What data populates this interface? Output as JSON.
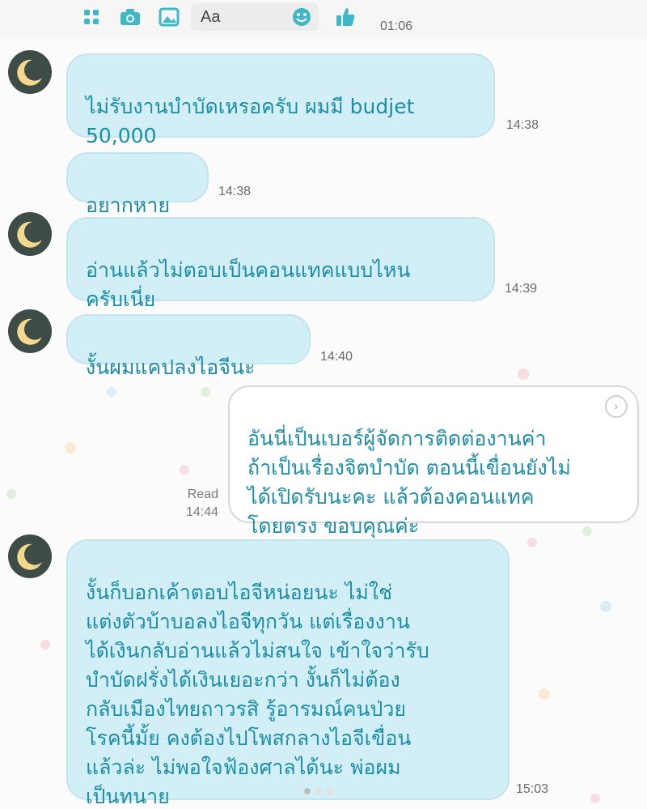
{
  "toolbar": {
    "icons": [
      "apps-icon",
      "camera-icon",
      "image-icon",
      "emoji-icon",
      "thumbs-up-icon"
    ],
    "input_placeholder": "Aa",
    "time": "01:06"
  },
  "messages": [
    {
      "sender": "other",
      "text": "ไม่รับงานบำบัดเหรอครับ ผมมี budjet\n50,000",
      "time": "14:38"
    },
    {
      "sender": "other",
      "text": "อยากหาย",
      "time": "14:38"
    },
    {
      "sender": "other",
      "text": "อ่านแล้วไม่ตอบเป็นคอนแทคแบบไหน\nครับเนี่ย",
      "time": "14:39"
    },
    {
      "sender": "other",
      "text": "งั้นผมแคปลงไอจีนะ",
      "time": "14:40"
    },
    {
      "sender": "me",
      "text": "อันนี่เป็นเบอร์ผู้จัดการติดต่องานค่า\nถ้าเป็นเรื่องจิตบำบัด ตอนนี้เขื่อนยังไม่\nได้เปิดรับนะคะ แล้วต้องคอนแทค\nโดยตรง ขอบคุณค่ะ",
      "status": "Read",
      "time": "14:44"
    },
    {
      "sender": "other",
      "text": "งั้นก็บอกเค้าตอบไอจีหน่อยนะ ไม่ใช่\nแต่งตัวบ้าบอลงไอจีทุกวัน แต่เรื่องงาน\nได้เงินกลับอ่านแล้วไม่สนใจ เข้าใจว่ารับ\nบำบัดฝรั่งได้เงินเยอะกว่า งั้นก็ไม่ต้อง\nกลับเมืองไทยถาวรสิ รู้อารมณ์คนป่วย\nโรคนี้มั้ย คงต้องไปโพสกลางไอจีเขื่อน\nแล้วล่ะ ไม่พอใจฟ้องศาลได้นะ พ่อผม\nเป็นทนาย",
      "time": "15:03"
    }
  ],
  "colors": {
    "accent": "#3fb8c6",
    "incoming_bubble": "#d2eef7",
    "outgoing_bubble": "#ffffff",
    "text": "#1d8ea6",
    "avatar_bg": "#3e4c48",
    "moon": "#f4d98c"
  }
}
